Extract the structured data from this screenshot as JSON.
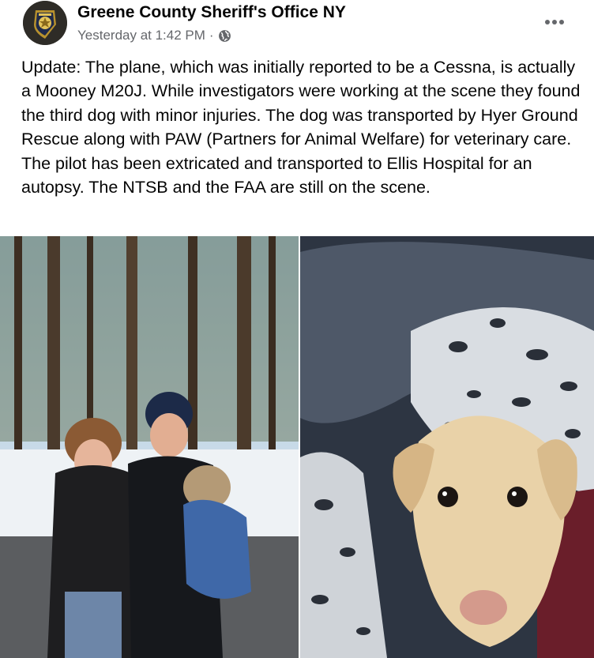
{
  "post": {
    "page_name": "Greene County Sheriff's Office NY",
    "timestamp": "Yesterday at 1:42 PM",
    "separator": "·",
    "privacy_icon": "globe-icon",
    "more_icon": "more-options-icon",
    "text": "Update: The plane, which was initially reported to be a Cessna, is actually a Mooney M20J. While investigators were working at the scene they found the third dog with minor injuries. The dog was transported by Hyer Ground Rescue along with PAW (Partners for Animal Welfare) for veterinary care. The pilot has been extricated and transported to Ellis Hospital for an autopsy. The NTSB and the FAA are still on the scene."
  },
  "colors": {
    "text_primary": "#050505",
    "text_secondary": "#65676b",
    "background": "#ffffff"
  }
}
